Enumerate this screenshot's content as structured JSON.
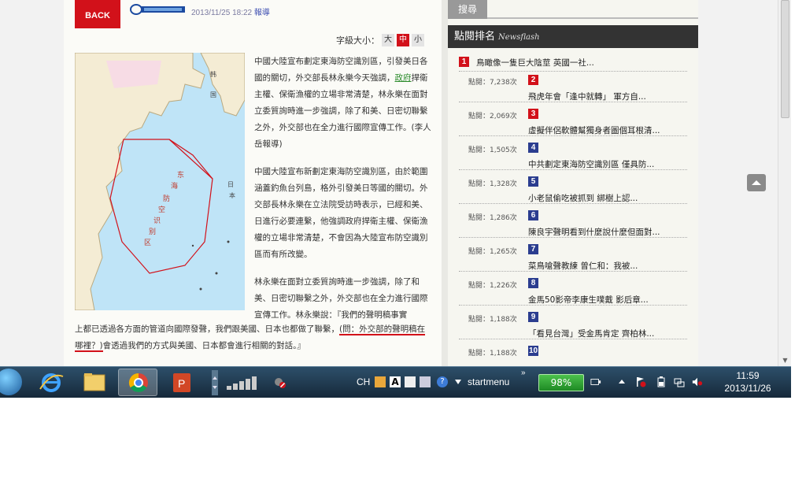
{
  "article": {
    "back_label": "BACK",
    "meta": "2013/11/25 18:22",
    "reporter": "報導",
    "fontsize_label": "字級大小：",
    "fontsize_options": [
      "大",
      "中",
      "小"
    ],
    "fontsize_selected": "中",
    "p1_a": "中國大陸宣布劃定東海防空識別區，引發美日各國的關切，外交部長林永樂今天強調，",
    "p1_link": "政府",
    "p1_b": "捍衛主權、保衛漁權的立場非常清楚，林永樂在面對立委質詢時進一步強調，除了和美、日密切聯繫之外，外交部也在全力進行國際宣傳工作。(李人岳報導)",
    "p2": "中國大陸宣布新劃定東海防空識別區，由於範圍涵蓋釣魚台列島，格外引發美日等國的關切。外交部長林永樂在立法院受訪時表示，已經和美、日進行必要連繫，他強調政府捍衛主權、保衛漁權的立場非常清楚，不會因為大陸宣布防空識別區而有所改變。",
    "p3_a": "林永樂在面對立委質詢時進一步強調，除了和美、日密切聯繫之外，外交部也在全力進行國際宣傳工作。林永樂說：『我們的聲明稿事實",
    "p3_b": "上都已透過各方面的管道向國際發聲，我們跟美國、日本也都做了聯繫，",
    "p3_question": "(問：外交部的聲明稿在哪裡？)",
    "p3_c": "會透過我們的方式與美國、日本都會進行相關的對話。』",
    "map_labels": [
      "韩",
      "国",
      "东",
      "海",
      "防",
      "空",
      "识",
      "别",
      "区",
      "日",
      "本"
    ]
  },
  "sidebar": {
    "search_label": "搜尋",
    "ranking_title": "點閱排名",
    "ranking_title_en": "Newsflash",
    "first": {
      "rank": "1",
      "title": "鳥瞰像一隻巨大陰莖 英國一社..."
    },
    "items": [
      {
        "hits": "點閱：7,238次",
        "rank": "2",
        "title": "飛虎年會「逢中就轉」 軍方自...",
        "color": "red"
      },
      {
        "hits": "點閱：2,069次",
        "rank": "3",
        "title": "虛擬伴侶軟體幫獨身者圖個耳根清...",
        "color": "red"
      },
      {
        "hits": "點閱：1,505次",
        "rank": "4",
        "title": "中共劃定東海防空識別區 僅具防...",
        "color": "blue"
      },
      {
        "hits": "點閱：1,328次",
        "rank": "5",
        "title": "小老鼠偷吃被抓到 綁樹上認...",
        "color": "blue"
      },
      {
        "hits": "點閱：1,286次",
        "rank": "6",
        "title": "陳良宇聲明看到什麼說什麼但面對...",
        "color": "blue"
      },
      {
        "hits": "點閱：1,265次",
        "rank": "7",
        "title": "菜鳥嗆聲教練 曾仁和：我被...",
        "color": "blue"
      },
      {
        "hits": "點閱：1,226次",
        "rank": "8",
        "title": "金馬50影帝李康生噗戴 影后章...",
        "color": "blue"
      },
      {
        "hits": "點閱：1,188次",
        "rank": "9",
        "title": "「看見台灣」受金馬肯定 齊柏林...",
        "color": "blue"
      },
      {
        "hits": "點閱：1,188次",
        "rank": "10",
        "title": "",
        "color": "blue"
      }
    ]
  },
  "taskbar": {
    "lang": "CH",
    "startmenu": "startmenu",
    "battery": "98%",
    "time": "11:59",
    "date": "2013/11/26",
    "apps": [
      "internet-explorer",
      "file-explorer",
      "chrome",
      "powerpoint"
    ]
  }
}
